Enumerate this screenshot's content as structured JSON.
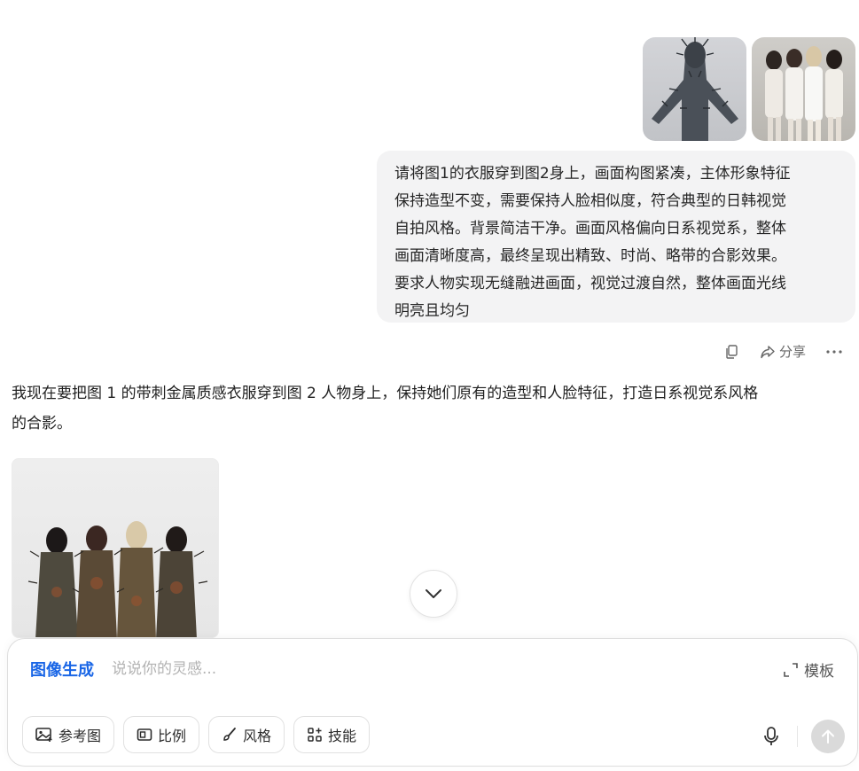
{
  "user_message": {
    "images": [
      {
        "alt": "图1",
        "icon": "spiked-figure-photo"
      },
      {
        "alt": "图2",
        "icon": "group-photo"
      }
    ],
    "text": "请将图1的衣服穿到图2身上，画面构图紧凑，主体形象特征\n保持造型不变，需要保持人脸相似度，符合典型的日韩视觉\n自拍风格。背景简洁干净。画面风格偏向日系视觉系，整体\n画面清晰度高，最终呈现出精致、时尚、略带的合影效果。\n要求人物实现无缝融进画面，视觉过渡自然，整体画面光线\n明亮且均匀"
  },
  "message_actions": {
    "copy_icon": "copy-icon",
    "share_label": "分享",
    "more_icon": "more-icon"
  },
  "assistant_message": {
    "text": "我现在要把图 1 的带刺金属质感衣服穿到图 2 人物身上，保持她们原有的造型和人脸特征，打造日系视觉系风格\n的合影。",
    "image_icon": "generated-group-image"
  },
  "composer": {
    "mode_label": "图像生成",
    "placeholder": "说说你的灵感...",
    "template_label": "模板",
    "tools": [
      {
        "label": "参考图",
        "icon": "image-icon"
      },
      {
        "label": "比例",
        "icon": "ratio-icon"
      },
      {
        "label": "风格",
        "icon": "brush-icon"
      },
      {
        "label": "技能",
        "icon": "apps-icon"
      }
    ],
    "accent_color": "#1a66e6"
  }
}
